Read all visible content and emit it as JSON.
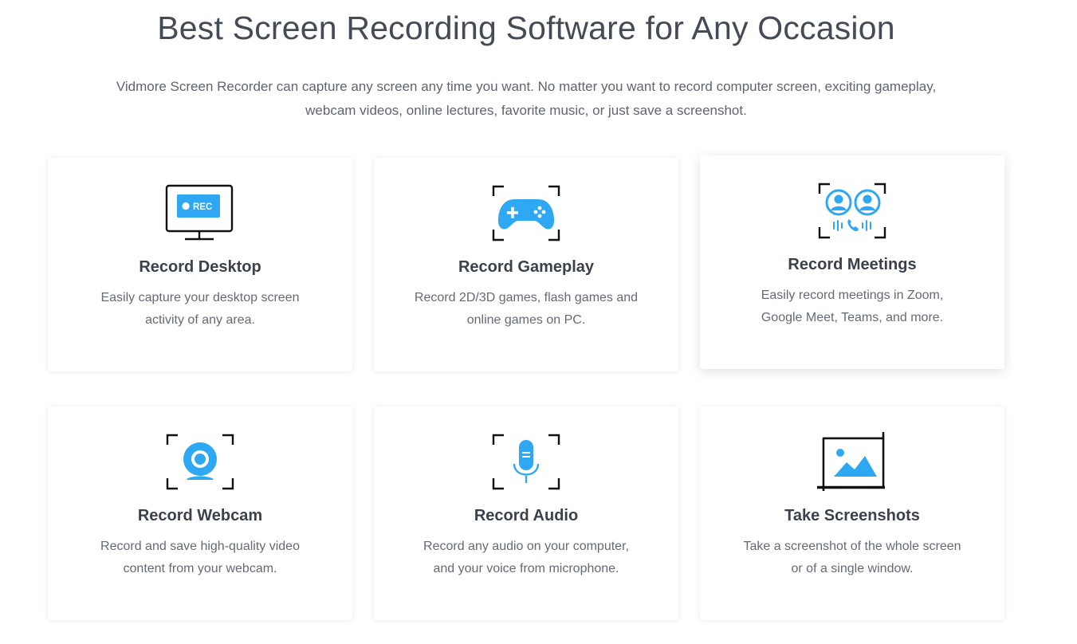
{
  "header": {
    "title": "Best Screen Recording Software for Any Occasion",
    "intro": "Vidmore Screen Recorder can capture any screen any time you want. No matter you want to record computer screen, exciting gameplay, webcam videos, online lectures, favorite music, or just save a screenshot."
  },
  "colors": {
    "accent": "#2ea8f2",
    "text": "#3b414b",
    "muted": "#646a75"
  },
  "features": [
    {
      "title": "Record Desktop",
      "description": "Easily capture your desktop screen activity of any area.",
      "icon": "monitor-rec-icon",
      "badge": "REC"
    },
    {
      "title": "Record Gameplay",
      "description": "Record 2D/3D games, flash games and online games on PC.",
      "icon": "gamepad-icon"
    },
    {
      "title": "Record Meetings",
      "description": "Easily record meetings in Zoom, Google Meet, Teams, and more.",
      "icon": "meeting-icon"
    },
    {
      "title": "Record Webcam",
      "description": "Record and save high-quality video content from your webcam.",
      "icon": "webcam-icon"
    },
    {
      "title": "Record Audio",
      "description": "Record any audio on your computer, and your voice from microphone.",
      "icon": "microphone-icon"
    },
    {
      "title": "Take Screenshots",
      "description": "Take a screenshot of the whole screen or of a single window.",
      "icon": "screenshot-icon"
    }
  ]
}
